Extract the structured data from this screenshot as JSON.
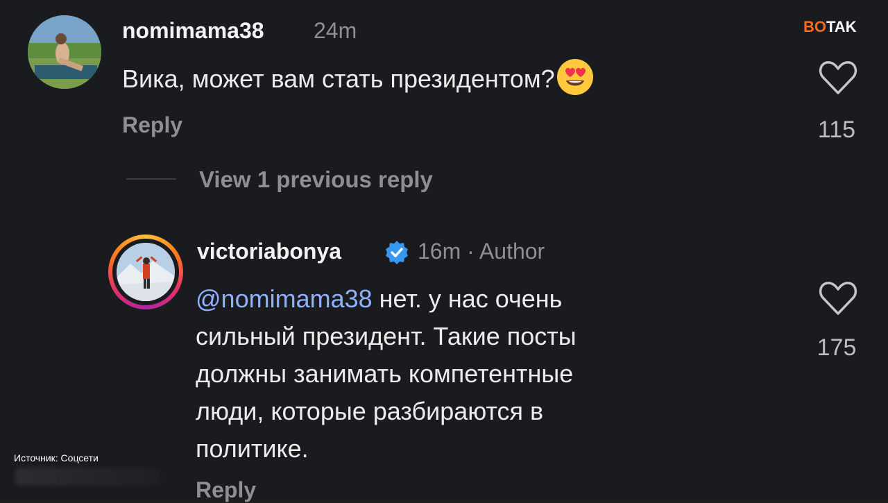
{
  "brand": {
    "part1": "BO",
    "part2": "TAK"
  },
  "comments": [
    {
      "username": "nomimama38",
      "time": "24m",
      "text": "Вика, может вам стать президентом?",
      "emoji": "heart-eyes-emoji",
      "reply_label": "Reply",
      "likes": "115"
    },
    {
      "username": "victoriabonya",
      "verified": true,
      "time": "16m · Author",
      "mention": "@nomimama38",
      "text_line1": " нет. у нас очень",
      "text_line2": "сильный президент.  Такие посты",
      "text_line3": "должны занимать компетентные",
      "text_line4": "люди, которые разбираются в",
      "text_line5": "политике.",
      "reply_label": "Reply",
      "likes": "175"
    }
  ],
  "view_previous": "View 1 previous reply",
  "source": "Источник: Соцсети",
  "colors": {
    "background": "#1a1b1f",
    "muted": "#8e8e93",
    "mention": "#8fb0ff",
    "verified": "#3897f0",
    "brand_accent": "#ff6a1a"
  },
  "icons": [
    "heart-outline-icon",
    "verified-badge-icon",
    "heart-eyes-emoji"
  ]
}
